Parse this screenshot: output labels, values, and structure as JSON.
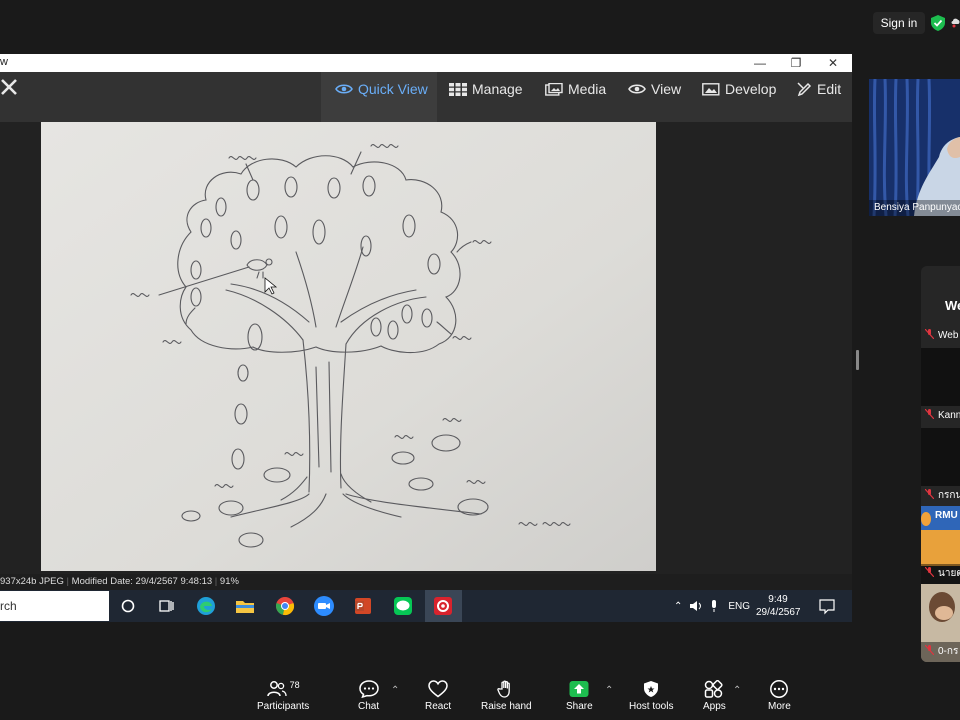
{
  "zoom": {
    "signin_label": "Sign in",
    "participant_name": "Bensiya Panpunyac",
    "side_labels": [
      "We",
      "Web",
      "Kann",
      "กรกน",
      "นายต",
      "0-กร"
    ],
    "side_banner_text": "RMU",
    "controls": {
      "participants_label": "Participants",
      "participants_count": "78",
      "chat_label": "Chat",
      "react_label": "React",
      "raise_hand_label": "Raise hand",
      "share_label": "Share",
      "host_tools_label": "Host tools",
      "apps_label": "Apps",
      "more_label": "More"
    },
    "colors": {
      "share_green": "#1dbd4f",
      "active_blue": "#6aaef8",
      "mic_red": "#e0343f"
    }
  },
  "window": {
    "title": "w",
    "toolbar": {
      "quick_view": "Quick View",
      "manage": "Manage",
      "media": "Media",
      "view": "View",
      "develop": "Develop",
      "edit": "Edit"
    },
    "status": {
      "info": "937x24b JPEG",
      "modified": "Modified Date: 29/4/2567 9:48:13",
      "zoom": "91%"
    }
  },
  "taskbar": {
    "search_label": "rch",
    "language": "ENG",
    "time": "9:49",
    "date": "29/4/2567",
    "apps": [
      "start-circle-icon",
      "task-view-icon",
      "edge-icon",
      "file-explorer-icon",
      "chrome-icon",
      "zoom-icon",
      "powerpoint-icon",
      "line-icon",
      "acdsee-icon"
    ]
  }
}
